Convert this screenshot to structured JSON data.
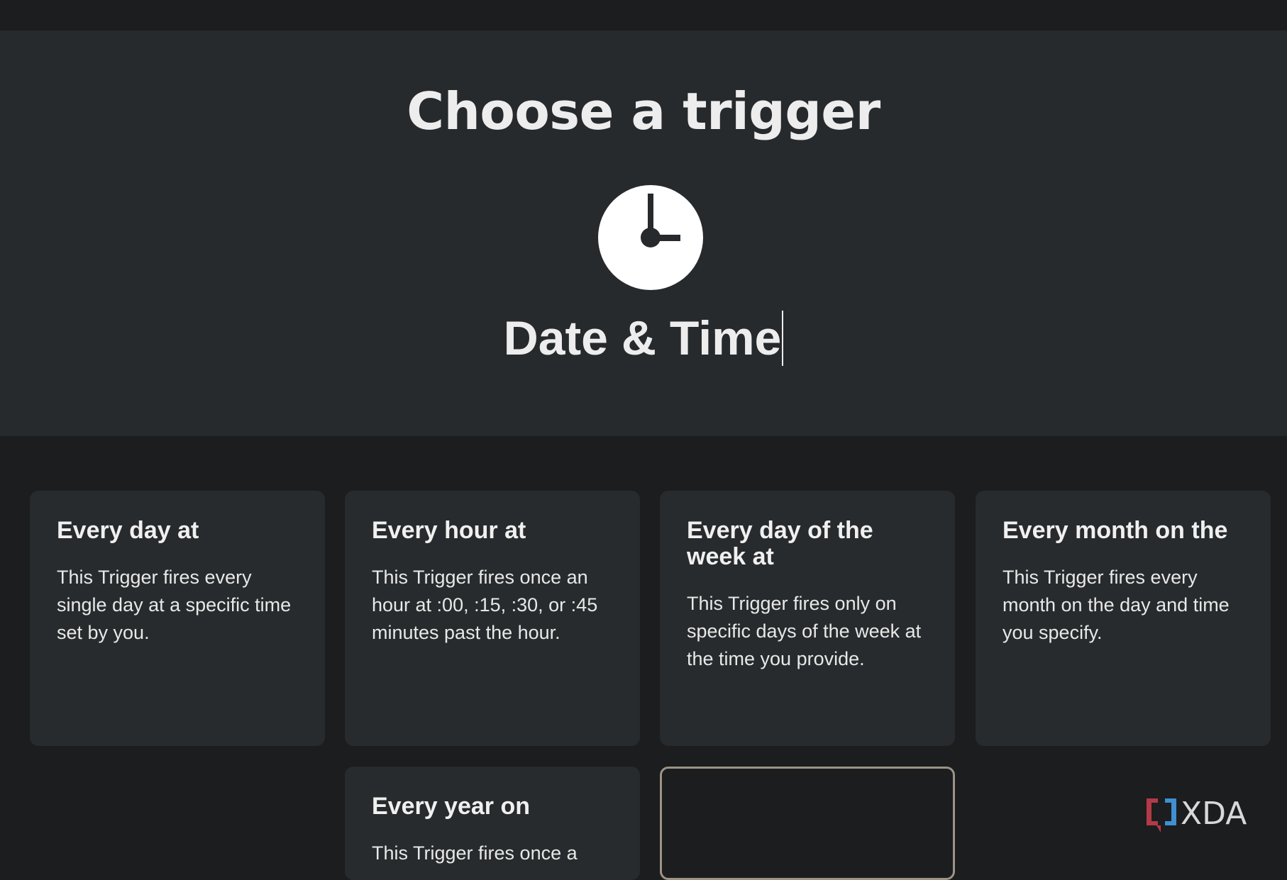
{
  "header": {
    "title": "Choose a trigger"
  },
  "service": {
    "name": "Date & Time",
    "icon": "clock-icon"
  },
  "triggers": [
    {
      "title": "Every day at",
      "description": "This Trigger fires every single day at a specific time set by you."
    },
    {
      "title": "Every hour at",
      "description": "This Trigger fires once an hour at :00, :15, :30, or :45 minutes past the hour."
    },
    {
      "title": "Every day of the week at",
      "description": "This Trigger fires only on specific days of the week at the time you provide."
    },
    {
      "title": "Every month on the",
      "description": "This Trigger fires every month on the day and time you specify."
    },
    {
      "title": "Every year on",
      "description": "This Trigger fires once a"
    }
  ],
  "watermark": {
    "brand": "XDA",
    "icon": "xda-logo-icon"
  },
  "colors": {
    "background": "#1b1d1f",
    "hero": "#262a2c",
    "card": "#272b2d",
    "selected_border": "#9d9286"
  }
}
